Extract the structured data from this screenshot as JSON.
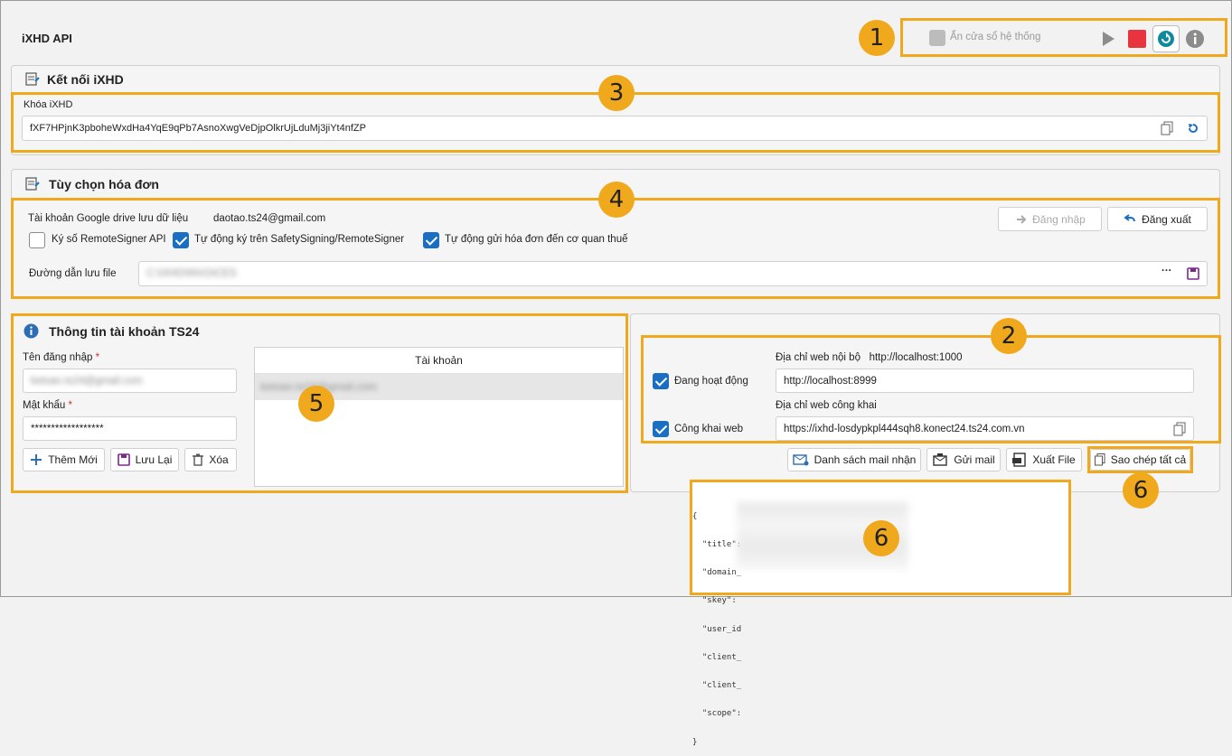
{
  "app": {
    "title": "iXHD API"
  },
  "toolbar": {
    "hide_label": "Ẩn cửa sổ hệ thống",
    "hide_checked": true
  },
  "badges": [
    "1",
    "2",
    "3",
    "4",
    "5",
    "6",
    "6"
  ],
  "connect": {
    "title": "Kết nối iXHD",
    "key_label": "Khóa iXHD",
    "key_value": "fXF7HPjnK3pboheWxdHa4YqE9qPb7AsnoXwgVeDjpOlkrUjLduMj3jiYt4nfZP"
  },
  "options": {
    "title": "Tùy chọn hóa đơn",
    "drive_label": "Tài khoản Google drive lưu dữ liệu",
    "drive_email": "daotao.ts24@gmail.com",
    "login_label": "Đăng nhập",
    "logout_label": "Đăng xuất",
    "chk_remote": "Ký số RemoteSigner API",
    "chk_remote_checked": false,
    "chk_auto_sign": "Tự động ký trên SafetySigning/RemoteSigner",
    "chk_auto_sign_checked": true,
    "chk_auto_send": "Tự động gửi hóa đơn đến cơ quan thuế",
    "chk_auto_send_checked": true,
    "path_label": "Đường dẫn lưu file",
    "path_value": "C:\\iXHD\\INVOICES",
    "more_label": "···"
  },
  "account": {
    "title": "Thông tin tài khoản TS24",
    "username_label": "Tên đăng nhập",
    "username_value": "ketoan.ts24@gmail.com",
    "password_label": "Mật khẩu",
    "password_value": "******************",
    "required_mark": "*",
    "add_label": "Thêm Mới",
    "save_label": "Lưu Lại",
    "delete_label": "Xóa",
    "list_header": "Tài khoản",
    "list_items": [
      "ketoan.ts24@gmail.com"
    ]
  },
  "web": {
    "local_label": "Địa chỉ web nội bộ",
    "local_value_top": "http://localhost:1000",
    "active_label": "Đang hoạt động",
    "active_checked": true,
    "local_input": "http://localhost:8999",
    "public_label": "Địa chỉ web công khai",
    "public_chk_label": "Công khai web",
    "public_checked": true,
    "public_input": "https://ixhd-losdypkpl444sqh8.konect24.ts24.com.vn",
    "mail_list_label": "Danh sách mail nhận",
    "send_mail_label": "Gửi mail",
    "export_label": "Xuất File",
    "copy_all_label": "Sao chép tất cả"
  },
  "json_preview": {
    "open": "{",
    "lines": [
      "  \"title\": ",
      "  \"domain_",
      "  \"skey\": ",
      "  \"user_id",
      "  \"client_",
      "  \"client_",
      "  \"scope\": "
    ],
    "close": "}"
  },
  "colors": {
    "accent": "#f0a81c",
    "check": "#1a6fc2",
    "stop": "#e8343f",
    "refresh": "#0f8a9c"
  }
}
